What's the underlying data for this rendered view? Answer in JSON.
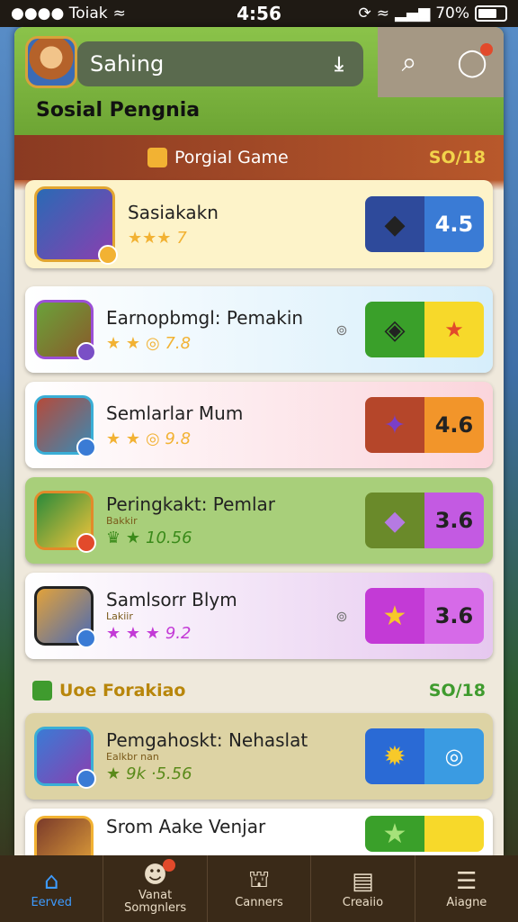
{
  "status_bar": {
    "carrier": "●●●● Toiak",
    "time": "4:56",
    "battery": "70%"
  },
  "header": {
    "search_text": "Sahing",
    "title": "Sosial Pengnia"
  },
  "section1": {
    "label": "Porgial Game",
    "count": "SO/18"
  },
  "section2": {
    "label": "Uoe Forakiao",
    "count": "SO/18"
  },
  "cards": [
    {
      "title": "Sasiakakn",
      "sub": "",
      "rating": "★★★",
      "rating_num": "7",
      "tile2": "4.5",
      "tile1_icon": "pink-box-icon"
    },
    {
      "title": "Earnopbmgl: Pemakin",
      "sub": "",
      "rating": "★ ★",
      "rating_num": "◎ 7.8",
      "tile2": "★",
      "tile1_icon": "sun-box-icon"
    },
    {
      "title": "Semlarlar Mum",
      "sub": "",
      "rating": "★ ★",
      "rating_num": "◎ 9.8",
      "tile2": "4.6",
      "tile1_icon": "star-box-icon"
    },
    {
      "title": "Peringkakt: Pemlar",
      "sub": "Bakkir",
      "rating": "♛ ★",
      "rating_num": "10.56",
      "tile2": "3.6",
      "tile1_icon": "purple-box-icon"
    },
    {
      "title": "Samlsorr Blym",
      "sub": "Lakiir",
      "rating": "★ ★ ★",
      "rating_num": "9.2",
      "tile2": "3.6",
      "tile1_icon": "star-icon"
    },
    {
      "title": "Pemgahoskt: Nehaslat",
      "sub": "Ealkbr nan",
      "rating": "★",
      "rating_num": "9k ·5.56",
      "tile2": "◎",
      "tile1_icon": "sun-icon"
    },
    {
      "title": "Srom Aake Venjar",
      "sub": "",
      "rating": "",
      "rating_num": "",
      "tile2": "",
      "tile1_icon": "star-icon"
    }
  ],
  "nav": [
    {
      "label": "Eerved",
      "icon": "home-icon"
    },
    {
      "label": "Vanat\nSomgnlers",
      "icon": "avatar-icon"
    },
    {
      "label": "Canners",
      "icon": "house-icon"
    },
    {
      "label": "Creaiio",
      "icon": "document-icon"
    },
    {
      "label": "Aiagne",
      "icon": "menu-icon"
    }
  ],
  "colors": {
    "header_green": "#8bc34a",
    "section_brown": "#8a3a22",
    "accent_blue": "#3d9bff",
    "navbar": "#3a2a18"
  }
}
